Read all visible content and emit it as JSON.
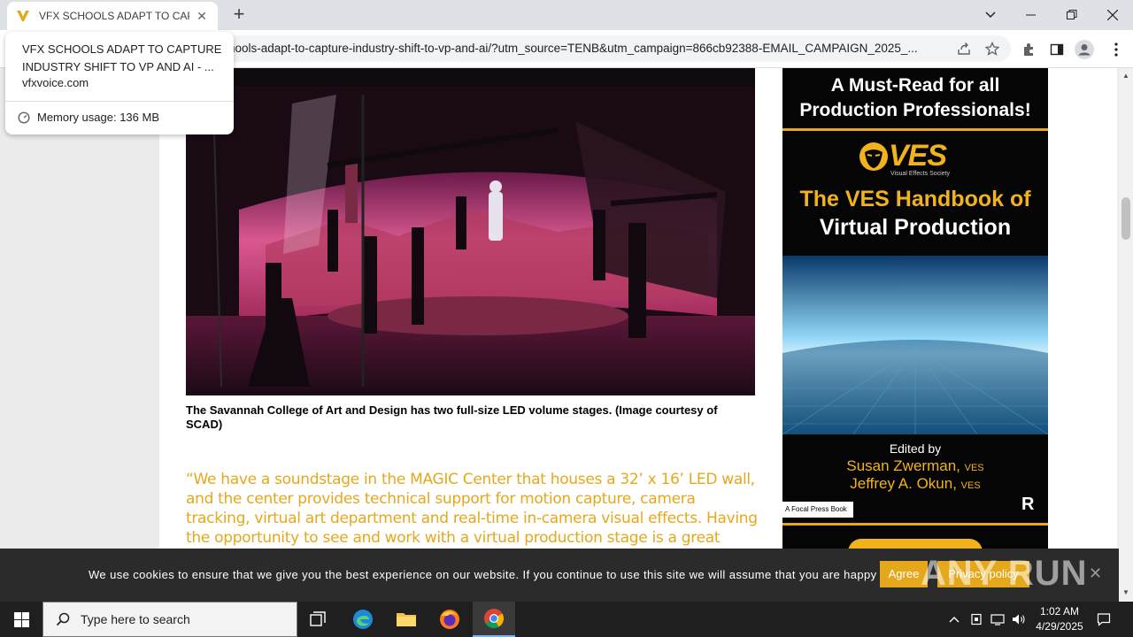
{
  "browser": {
    "tab_title": "VFX SCHOOLS ADAPT TO CAPTU",
    "url": "hools-adapt-to-capture-industry-shift-to-vp-and-ai/?utm_source=TENB&utm_campaign=866cb92388-EMAIL_CAMPAIGN_2025_..."
  },
  "hovercard": {
    "title": "VFX SCHOOLS ADAPT TO CAPTURE INDUSTRY SHIFT TO VP AND AI - ...",
    "domain": "vfxvoice.com",
    "memory": "Memory usage: 136 MB"
  },
  "article": {
    "caption": "The Savannah College of Art and Design has two full-size LED volume stages. (Image courtesy of SCAD)",
    "quote": "“We have a soundstage in the MAGIC Center that houses a 32’ x 16’ LED wall, and the center provides technical support for motion capture, camera tracking, virtual art department and real-time in-camera visual effects. Having the opportunity to see and work with a virtual production stage is a great asset for our graduates.”"
  },
  "ad": {
    "headline_1": "A Must-Read for all",
    "headline_2": "Production Professionals!",
    "logo_text": "VES",
    "logo_sub": "Visual Effects Society",
    "book_title_1": "The VES Handbook of",
    "book_title_2": "Virtual Production",
    "edited_by": "Edited by",
    "editor_1": "Susan Zwerman,",
    "editor_1_suffix": "VES",
    "editor_2": "Jeffrey A. Okun,",
    "editor_2_suffix": "VES",
    "publisher": "A Focal Press Book",
    "publisher_logo": "R"
  },
  "cookie": {
    "message": "We use cookies to ensure that we give you the best experience on our website. If you continue to use this site we will assume that you are happy with it.",
    "agree": "Agree",
    "privacy": "Privacy policy",
    "watermark": "ANY RUN"
  },
  "taskbar": {
    "search_placeholder": "Type here to search",
    "time": "1:02 AM",
    "date": "4/29/2025"
  },
  "colors": {
    "accent_gold": "#e5a81c",
    "cookie_bg": "#2b2b2b",
    "taskbar_bg": "#1f1f1f"
  }
}
